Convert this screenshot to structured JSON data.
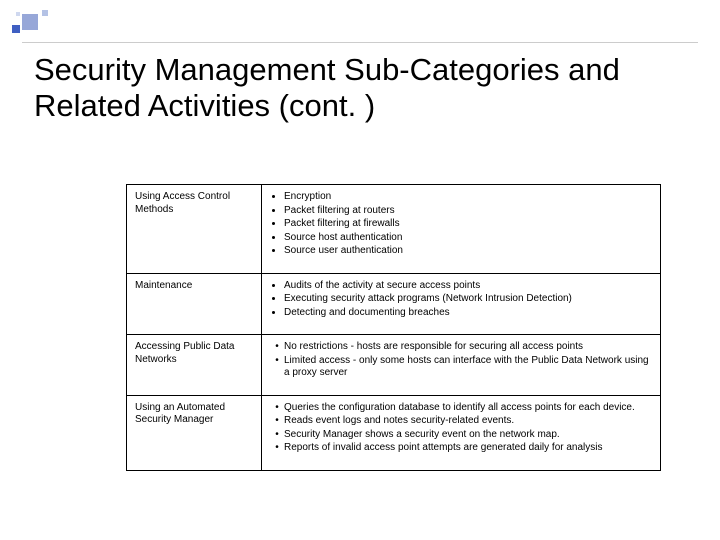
{
  "title": "Security Management Sub-Categories and Related Activities (cont. )",
  "rows": [
    {
      "category": "Using Access Control Methods",
      "items": [
        "Encryption",
        "Packet filtering at routers",
        "Packet filtering at firewalls",
        "Source host authentication",
        "Source user authentication"
      ]
    },
    {
      "category": "Maintenance",
      "items": [
        "Audits of the activity at secure access points",
        "Executing security attack programs (Network Intrusion Detection)",
        "Detecting and documenting  breaches"
      ]
    },
    {
      "category": "Accessing Public Data Networks",
      "items": [
        "No restrictions - hosts are responsible for securing all access points",
        "Limited access - only some hosts can interface with the Public Data Network using a proxy server"
      ]
    },
    {
      "category": "Using an Automated Security Manager",
      "items": [
        "Queries the configuration database to identify all access points for each device.",
        "Reads event logs and notes security-related events.",
        "Security Manager shows a security event on the network map.",
        "Reports of  invalid access point attempts are generated daily for analysis"
      ]
    }
  ]
}
